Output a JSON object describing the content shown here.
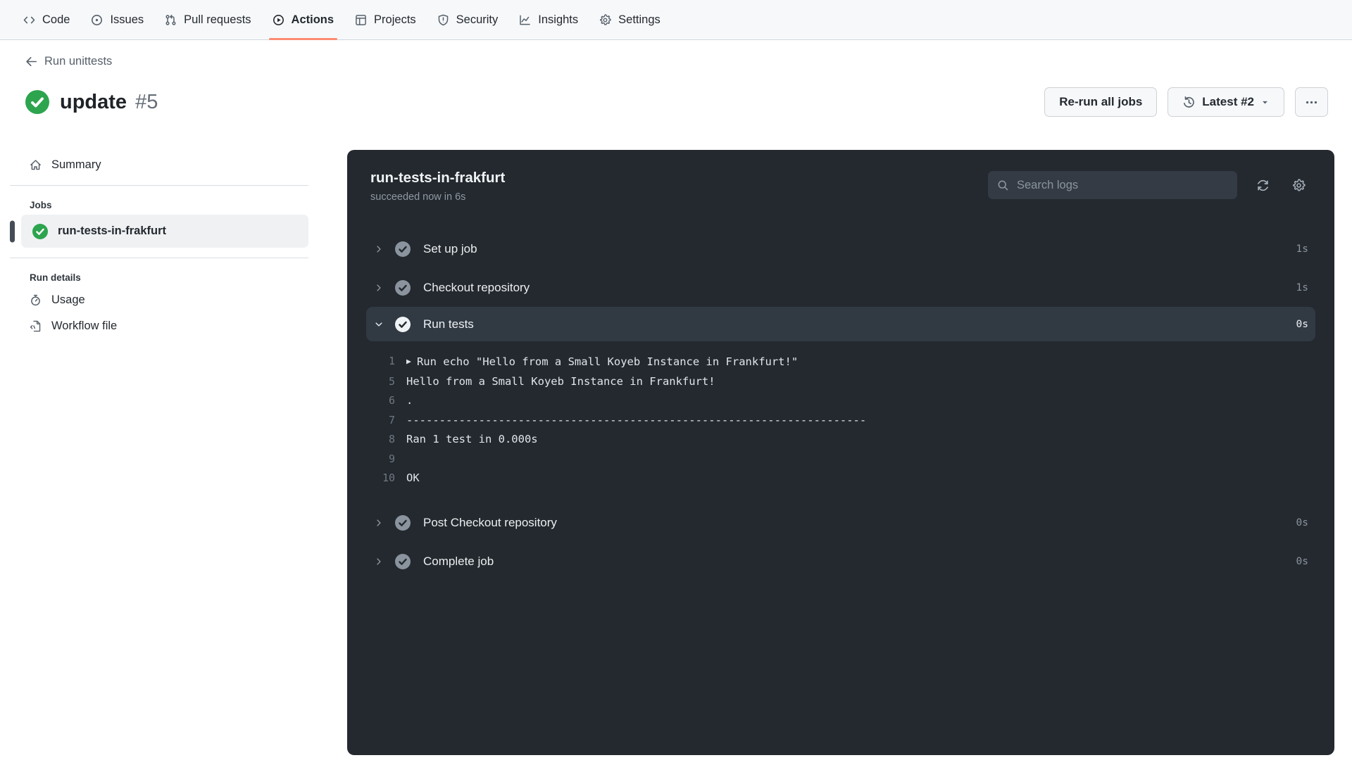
{
  "nav": {
    "items": [
      {
        "label": "Code",
        "icon": "code-icon",
        "active": false
      },
      {
        "label": "Issues",
        "icon": "issue-opened-icon",
        "active": false
      },
      {
        "label": "Pull requests",
        "icon": "git-pull-request-icon",
        "active": false
      },
      {
        "label": "Actions",
        "icon": "play-circle-icon",
        "active": true
      },
      {
        "label": "Projects",
        "icon": "table-icon",
        "active": false
      },
      {
        "label": "Security",
        "icon": "shield-icon",
        "active": false
      },
      {
        "label": "Insights",
        "icon": "graph-icon",
        "active": false
      },
      {
        "label": "Settings",
        "icon": "gear-icon",
        "active": false
      }
    ]
  },
  "header": {
    "back_label": "Run unittests",
    "title": "update",
    "run_number": "#5",
    "rerun_label": "Re-run all jobs",
    "latest_label": "Latest #2"
  },
  "sidebar": {
    "summary_label": "Summary",
    "jobs_heading": "Jobs",
    "job_name": "run-tests-in-frakfurt",
    "run_details_heading": "Run details",
    "usage_label": "Usage",
    "workflow_label": "Workflow file"
  },
  "panel": {
    "job_title": "run-tests-in-frakfurt",
    "job_status": "succeeded now in 6s",
    "search_placeholder": "Search logs",
    "steps": [
      {
        "name": "Set up job",
        "duration": "1s",
        "state": "collapsed"
      },
      {
        "name": "Checkout repository",
        "duration": "1s",
        "state": "collapsed"
      },
      {
        "name": "Run tests",
        "duration": "0s",
        "state": "expanded"
      },
      {
        "name": "Post Checkout repository",
        "duration": "0s",
        "state": "collapsed"
      },
      {
        "name": "Complete job",
        "duration": "0s",
        "state": "collapsed"
      }
    ],
    "log_lines": [
      {
        "num": "1",
        "prefix": "▶",
        "text": "Run echo \"Hello from a Small Koyeb Instance in Frankfurt!\""
      },
      {
        "num": "5",
        "prefix": "",
        "text": "Hello from a Small Koyeb Instance in Frankfurt!"
      },
      {
        "num": "6",
        "prefix": "",
        "text": "."
      },
      {
        "num": "7",
        "prefix": "",
        "text": "----------------------------------------------------------------------"
      },
      {
        "num": "8",
        "prefix": "",
        "text": "Ran 1 test in 0.000s"
      },
      {
        "num": "9",
        "prefix": "",
        "text": ""
      },
      {
        "num": "10",
        "prefix": "",
        "text": "OK"
      }
    ]
  },
  "colors": {
    "accent_underline": "#fd8c73",
    "success_green": "#2da44e",
    "panel_bg": "#24292f"
  }
}
